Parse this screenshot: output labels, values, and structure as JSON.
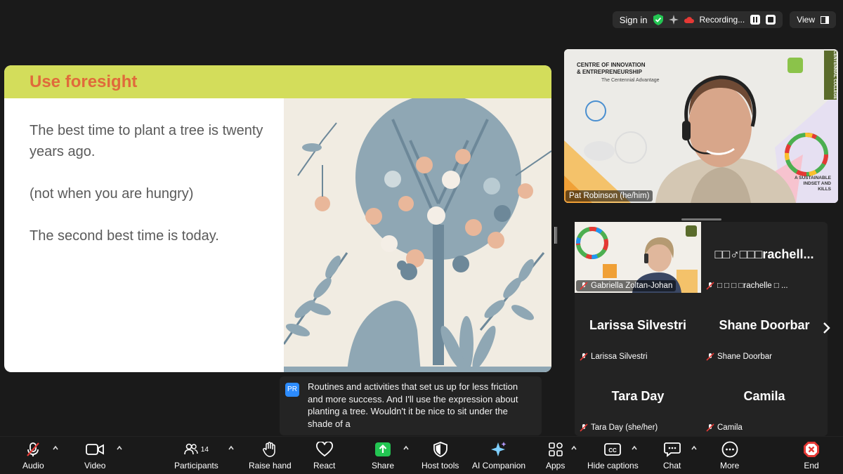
{
  "topbar": {
    "sign_in": "Sign in",
    "recording": "Recording...",
    "view": "View"
  },
  "slide": {
    "title": "Use foresight",
    "line1": "The best time to plant a tree is twenty years ago.",
    "line2": "(not when you are hungry)",
    "line3": "The second best time is today."
  },
  "speaker": {
    "name": "Pat Robinson (he/him)",
    "bg_org": "CENTRE OF INNOVATION & ENTREPRENEURSHIP",
    "bg_tagline": "The Centennial Advantage",
    "bg_college": "CENTENNIAL COLLEGE",
    "bg_fragment1": "A SUSTAINABLE",
    "bg_fragment2": "INDSET AND",
    "bg_fragment3": "KILLS"
  },
  "gallery": {
    "tiles": [
      {
        "display": "",
        "label": "Gabriella Zoltan-Johan"
      },
      {
        "display": "□□♂□□□rachell...",
        "label": "□ □ □ □rachelle □ ..."
      },
      {
        "display": "Larissa Silvestri",
        "label": "Larissa Silvestri"
      },
      {
        "display": "Shane Doorbar",
        "label": "Shane Doorbar"
      },
      {
        "display": "Tara Day",
        "label": "Tara Day (she/her)"
      },
      {
        "display": "Camila",
        "label": "Camila"
      }
    ]
  },
  "caption": {
    "initials": "PR",
    "text": "Routines and activities that set us up for less friction and more success. And I'll use the expression about planting a tree. Wouldn't it be nice to sit under the shade of a"
  },
  "toolbar": {
    "audio": "Audio",
    "video": "Video",
    "participants": "Participants",
    "participants_count": "14",
    "raise_hand": "Raise hand",
    "react": "React",
    "share": "Share",
    "host_tools": "Host tools",
    "ai_companion": "AI Companion",
    "apps": "Apps",
    "hide_captions": "Hide captions",
    "chat": "Chat",
    "more": "More",
    "end": "End"
  },
  "colors": {
    "slide_header": "#d3dd5b",
    "slide_title": "#e06a3b",
    "share_green": "#23c552",
    "end_red": "#e53935",
    "caption_avatar": "#2d8cff"
  }
}
